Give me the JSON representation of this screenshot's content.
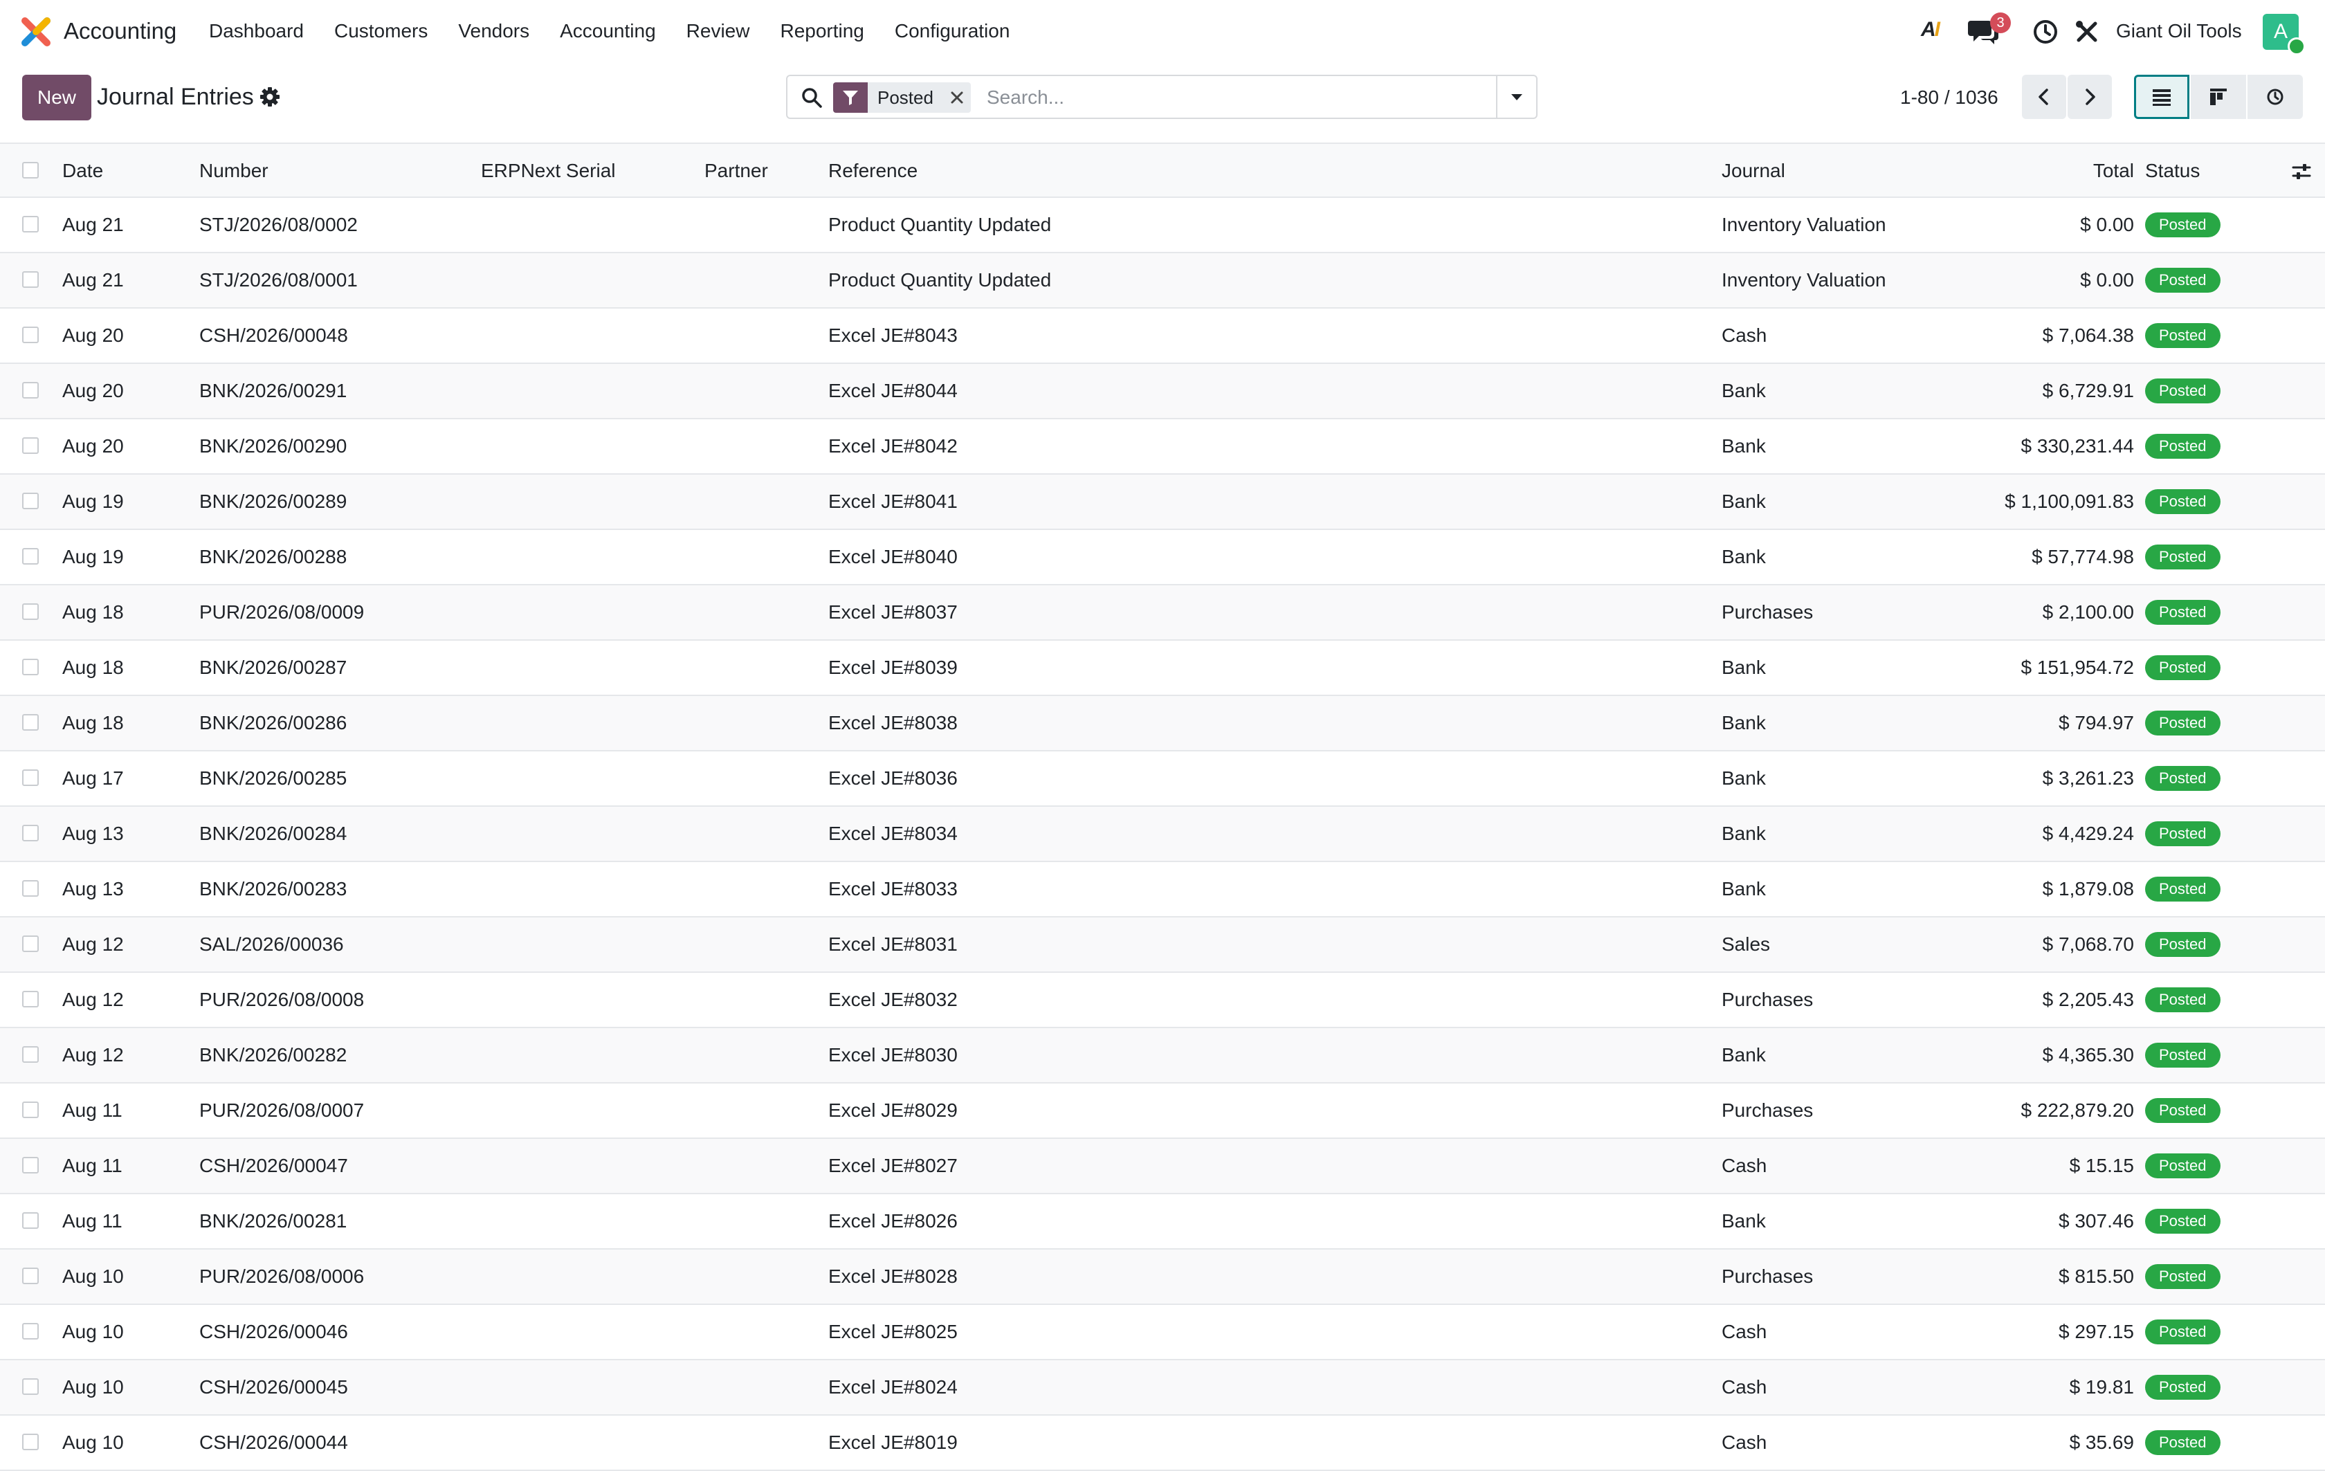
{
  "navbar": {
    "app_name": "Accounting",
    "menu": [
      "Dashboard",
      "Customers",
      "Vendors",
      "Accounting",
      "Review",
      "Reporting",
      "Configuration"
    ],
    "ai_label_a": "A",
    "ai_label_i": "I",
    "messages_count": "3",
    "company": "Giant Oil Tools",
    "avatar_initial": "A"
  },
  "control": {
    "new_label": "New",
    "title": "Journal Entries",
    "facet_label": "Posted",
    "search_placeholder": "Search...",
    "pager": "1-80 / 1036"
  },
  "colors": {
    "brand": "#714b67",
    "status_posted": "#28a745",
    "active_view": "#017e84",
    "badge": "#d44c59"
  },
  "table": {
    "headers": {
      "date": "Date",
      "number": "Number",
      "erp": "ERPNext Serial",
      "partner": "Partner",
      "reference": "Reference",
      "journal": "Journal",
      "total": "Total",
      "status": "Status"
    },
    "rows": [
      {
        "date": "Aug 21",
        "number": "STJ/2026/08/0002",
        "erp": "",
        "partner": "",
        "reference": "Product Quantity Updated",
        "journal": "Inventory Valuation",
        "total": "$ 0.00",
        "status": "Posted"
      },
      {
        "date": "Aug 21",
        "number": "STJ/2026/08/0001",
        "erp": "",
        "partner": "",
        "reference": "Product Quantity Updated",
        "journal": "Inventory Valuation",
        "total": "$ 0.00",
        "status": "Posted"
      },
      {
        "date": "Aug 20",
        "number": "CSH/2026/00048",
        "erp": "",
        "partner": "",
        "reference": "Excel JE#8043",
        "journal": "Cash",
        "total": "$ 7,064.38",
        "status": "Posted"
      },
      {
        "date": "Aug 20",
        "number": "BNK/2026/00291",
        "erp": "",
        "partner": "",
        "reference": "Excel JE#8044",
        "journal": "Bank",
        "total": "$ 6,729.91",
        "status": "Posted"
      },
      {
        "date": "Aug 20",
        "number": "BNK/2026/00290",
        "erp": "",
        "partner": "",
        "reference": "Excel JE#8042",
        "journal": "Bank",
        "total": "$ 330,231.44",
        "status": "Posted"
      },
      {
        "date": "Aug 19",
        "number": "BNK/2026/00289",
        "erp": "",
        "partner": "",
        "reference": "Excel JE#8041",
        "journal": "Bank",
        "total": "$ 1,100,091.83",
        "status": "Posted"
      },
      {
        "date": "Aug 19",
        "number": "BNK/2026/00288",
        "erp": "",
        "partner": "",
        "reference": "Excel JE#8040",
        "journal": "Bank",
        "total": "$ 57,774.98",
        "status": "Posted"
      },
      {
        "date": "Aug 18",
        "number": "PUR/2026/08/0009",
        "erp": "",
        "partner": "",
        "reference": "Excel JE#8037",
        "journal": "Purchases",
        "total": "$ 2,100.00",
        "status": "Posted"
      },
      {
        "date": "Aug 18",
        "number": "BNK/2026/00287",
        "erp": "",
        "partner": "",
        "reference": "Excel JE#8039",
        "journal": "Bank",
        "total": "$ 151,954.72",
        "status": "Posted"
      },
      {
        "date": "Aug 18",
        "number": "BNK/2026/00286",
        "erp": "",
        "partner": "",
        "reference": "Excel JE#8038",
        "journal": "Bank",
        "total": "$ 794.97",
        "status": "Posted"
      },
      {
        "date": "Aug 17",
        "number": "BNK/2026/00285",
        "erp": "",
        "partner": "",
        "reference": "Excel JE#8036",
        "journal": "Bank",
        "total": "$ 3,261.23",
        "status": "Posted"
      },
      {
        "date": "Aug 13",
        "number": "BNK/2026/00284",
        "erp": "",
        "partner": "",
        "reference": "Excel JE#8034",
        "journal": "Bank",
        "total": "$ 4,429.24",
        "status": "Posted"
      },
      {
        "date": "Aug 13",
        "number": "BNK/2026/00283",
        "erp": "",
        "partner": "",
        "reference": "Excel JE#8033",
        "journal": "Bank",
        "total": "$ 1,879.08",
        "status": "Posted"
      },
      {
        "date": "Aug 12",
        "number": "SAL/2026/00036",
        "erp": "",
        "partner": "",
        "reference": "Excel JE#8031",
        "journal": "Sales",
        "total": "$ 7,068.70",
        "status": "Posted"
      },
      {
        "date": "Aug 12",
        "number": "PUR/2026/08/0008",
        "erp": "",
        "partner": "",
        "reference": "Excel JE#8032",
        "journal": "Purchases",
        "total": "$ 2,205.43",
        "status": "Posted"
      },
      {
        "date": "Aug 12",
        "number": "BNK/2026/00282",
        "erp": "",
        "partner": "",
        "reference": "Excel JE#8030",
        "journal": "Bank",
        "total": "$ 4,365.30",
        "status": "Posted"
      },
      {
        "date": "Aug 11",
        "number": "PUR/2026/08/0007",
        "erp": "",
        "partner": "",
        "reference": "Excel JE#8029",
        "journal": "Purchases",
        "total": "$ 222,879.20",
        "status": "Posted"
      },
      {
        "date": "Aug 11",
        "number": "CSH/2026/00047",
        "erp": "",
        "partner": "",
        "reference": "Excel JE#8027",
        "journal": "Cash",
        "total": "$ 15.15",
        "status": "Posted"
      },
      {
        "date": "Aug 11",
        "number": "BNK/2026/00281",
        "erp": "",
        "partner": "",
        "reference": "Excel JE#8026",
        "journal": "Bank",
        "total": "$ 307.46",
        "status": "Posted"
      },
      {
        "date": "Aug 10",
        "number": "PUR/2026/08/0006",
        "erp": "",
        "partner": "",
        "reference": "Excel JE#8028",
        "journal": "Purchases",
        "total": "$ 815.50",
        "status": "Posted"
      },
      {
        "date": "Aug 10",
        "number": "CSH/2026/00046",
        "erp": "",
        "partner": "",
        "reference": "Excel JE#8025",
        "journal": "Cash",
        "total": "$ 297.15",
        "status": "Posted"
      },
      {
        "date": "Aug 10",
        "number": "CSH/2026/00045",
        "erp": "",
        "partner": "",
        "reference": "Excel JE#8024",
        "journal": "Cash",
        "total": "$ 19.81",
        "status": "Posted"
      },
      {
        "date": "Aug 10",
        "number": "CSH/2026/00044",
        "erp": "",
        "partner": "",
        "reference": "Excel JE#8019",
        "journal": "Cash",
        "total": "$ 35.69",
        "status": "Posted"
      }
    ]
  }
}
